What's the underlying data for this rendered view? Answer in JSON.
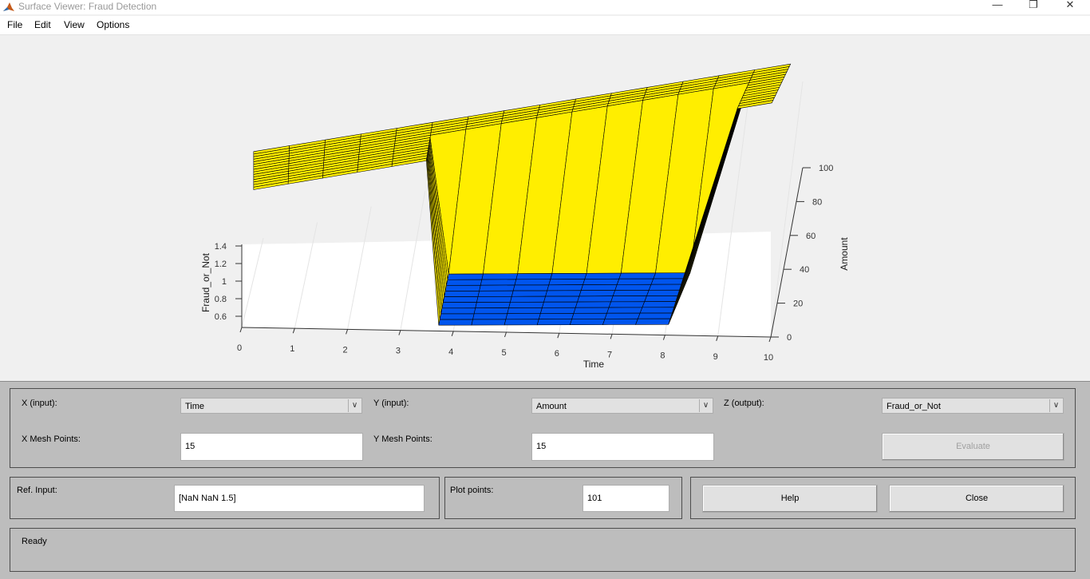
{
  "window": {
    "title": "Surface Viewer: Fraud Detection",
    "minimize_glyph": "—",
    "restore_glyph": "❐",
    "close_glyph": "✕",
    "app_icon": "matlab-logo-icon"
  },
  "menu": {
    "items": [
      "File",
      "Edit",
      "View",
      "Options"
    ]
  },
  "chart_data": {
    "type": "surface",
    "xlabel": "Time",
    "ylabel": "Amount",
    "zlabel": "Fraud_or_Not",
    "x_ticks": [
      "0",
      "1",
      "2",
      "3",
      "4",
      "5",
      "6",
      "7",
      "8",
      "9",
      "10"
    ],
    "y_ticks": [
      "0",
      "20",
      "40",
      "60",
      "80",
      "100"
    ],
    "z_ticks": [
      "0.6",
      "0.8",
      "1",
      "1.2",
      "1.4"
    ],
    "xlim": [
      0,
      10
    ],
    "ylim": [
      0,
      100
    ],
    "zlim": [
      0.5,
      1.5
    ],
    "x_mesh_points": 15,
    "y_mesh_points": 15,
    "colors": {
      "high": "#ffee00",
      "low": "#0055ee",
      "axis": "#333333",
      "grid": "#e4e4e4"
    }
  },
  "controls": {
    "x_input": {
      "label": "X (input):",
      "value": "Time"
    },
    "y_input": {
      "label": "Y (input):",
      "value": "Amount"
    },
    "z_output": {
      "label": "Z (output):",
      "value": "Fraud_or_Not"
    },
    "x_mesh": {
      "label": "X Mesh Points:",
      "value": "15"
    },
    "y_mesh": {
      "label": "Y Mesh Points:",
      "value": "15"
    },
    "evaluate_label": "Evaluate",
    "ref_input": {
      "label": "Ref. Input:",
      "value": "[NaN NaN 1.5]"
    },
    "plot_points": {
      "label": "Plot points:",
      "value": "101"
    },
    "help_label": "Help",
    "close_label": "Close",
    "status": "Ready"
  }
}
